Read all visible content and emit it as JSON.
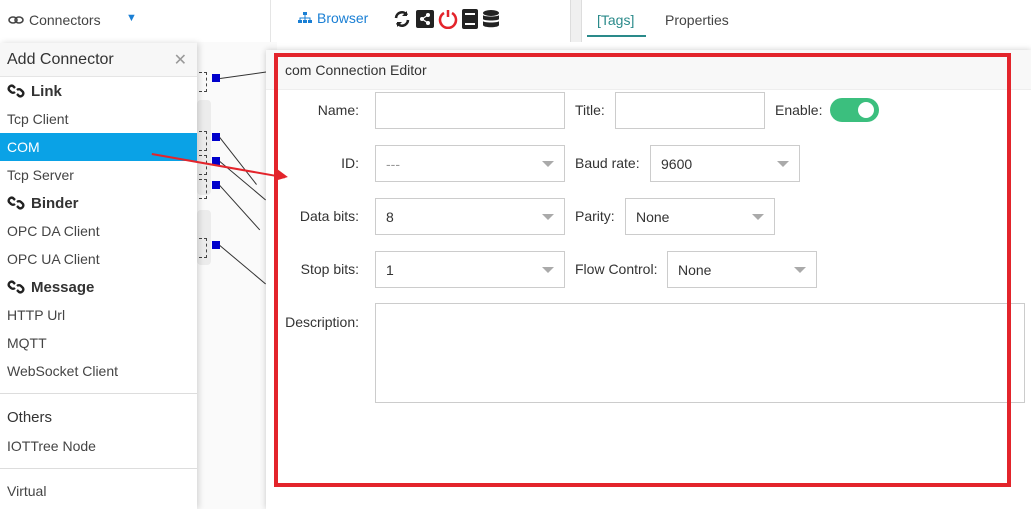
{
  "topbar": {
    "connectors_label": "Connectors",
    "browser_label": "Browser",
    "tabs": [
      {
        "label": "[Tags]"
      },
      {
        "label": "Properties"
      }
    ]
  },
  "menu": {
    "title": "Add Connector",
    "groups": {
      "link": "Link",
      "binder": "Binder",
      "message": "Message",
      "others": "Others"
    },
    "items": {
      "tcp_client": "Tcp Client",
      "com": "COM",
      "tcp_server": "Tcp Server",
      "opc_da": "OPC DA Client",
      "opc_ua": "OPC UA Client",
      "http_url": "HTTP Url",
      "mqtt": "MQTT",
      "websocket": "WebSocket Client",
      "iottree_node": "IOTTree Node",
      "virtual": "Virtual"
    }
  },
  "dialog": {
    "title": "com Connection Editor",
    "labels": {
      "name": "Name:",
      "title": "Title:",
      "enable": "Enable:",
      "id": "ID:",
      "baud_rate": "Baud rate:",
      "data_bits": "Data bits:",
      "parity": "Parity:",
      "stop_bits": "Stop bits:",
      "flow_control": "Flow Control:",
      "description": "Description:"
    },
    "values": {
      "id": "---",
      "baud_rate": "9600",
      "data_bits": "8",
      "parity": "None",
      "stop_bits": "1",
      "flow_control": "None",
      "enabled": true
    }
  },
  "colors": {
    "accent_blue": "#0aa2e6",
    "highlight_red": "#e3242b",
    "toggle_green": "#3bbf7e",
    "tab_teal": "#2a8a8a"
  }
}
